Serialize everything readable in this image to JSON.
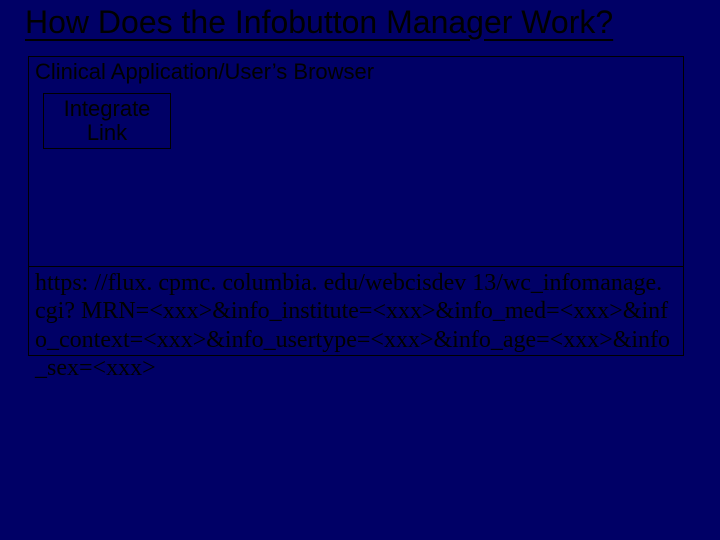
{
  "title": "How Does the Infobutton Manager Work?",
  "outer_box": {
    "label": "Clinical Application/User’s Browser"
  },
  "inner_box": {
    "label": "Integrate\nLink"
  },
  "url_text": "https: //flux. cpmc. columbia. edu/webcisdev 13/wc_infomanage. cgi? MRN=<xxx>&info_institute=<xxx>&info_med=<xxx>&info_context=<xxx>&info_usertype=<xxx>&info_age=<xxx>&info_sex=<xxx>"
}
